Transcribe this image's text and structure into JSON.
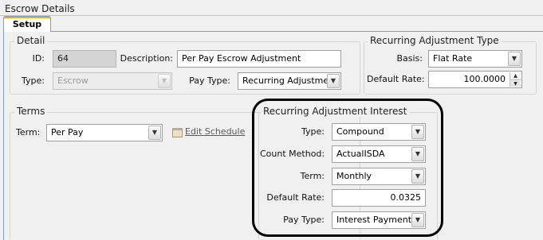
{
  "window": {
    "title": "Escrow Details"
  },
  "tabs": [
    {
      "label": "Setup"
    }
  ],
  "detail": {
    "legend": "Detail",
    "id_label": "ID:",
    "id_value": "64",
    "description_label": "Description:",
    "description_value": "Per Pay Escrow Adjustment",
    "type_label": "Type:",
    "type_value": "Escrow",
    "pay_type_label": "Pay Type:",
    "pay_type_value": "Recurring Adjustmen"
  },
  "recurring_type": {
    "legend": "Recurring Adjustment Type",
    "basis_label": "Basis:",
    "basis_value": "Flat Rate",
    "default_rate_label": "Default Rate:",
    "default_rate_value": "100.0000"
  },
  "terms": {
    "legend": "Terms",
    "term_label": "Term:",
    "term_value": "Per Pay",
    "edit_schedule_label": "Edit Schedule"
  },
  "interest": {
    "legend": "Recurring Adjustment Interest",
    "type_label": "Type:",
    "type_value": "Compound",
    "count_method_label": "Count Method:",
    "count_method_value": "ActualISDA",
    "term_label": "Term:",
    "term_value": "Monthly",
    "default_rate_label": "Default Rate:",
    "default_rate_value": "0.0325",
    "pay_type_label": "Pay Type:",
    "pay_type_value": "Interest Payment"
  },
  "icons": {
    "dropdown": "chevron-down-icon",
    "spinner_up": "spinner-up-icon",
    "spinner_down": "spinner-down-icon",
    "schedule": "calendar-icon"
  },
  "colors": {
    "callout_border": "#000000",
    "readonly_bg": "#d4d4d4"
  }
}
